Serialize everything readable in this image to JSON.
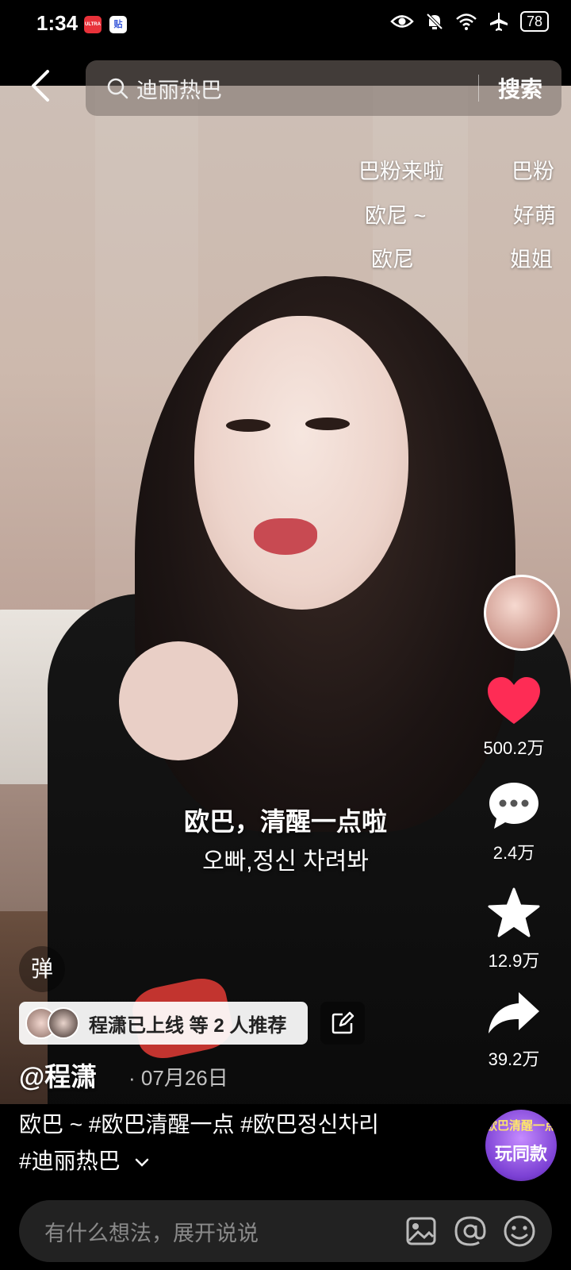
{
  "status_bar": {
    "time": "1:34",
    "app_badge_1": "ULTRA",
    "app_badge_2": "贴",
    "battery": "78"
  },
  "header": {
    "search_query": "迪丽热巴",
    "search_button": "搜索"
  },
  "danmaku": {
    "col1": [
      "巴粉来啦",
      "欧尼 ~",
      "欧尼"
    ],
    "col2": [
      "巴粉",
      "好萌",
      "姐姐"
    ]
  },
  "subtitles": {
    "chinese": "欧巴，清醒一点啦",
    "korean": "오빠,정신 차려봐"
  },
  "actions": {
    "like_count": "500.2万",
    "comment_count": "2.4万",
    "favorite_count": "12.9万",
    "share_count": "39.2万",
    "like_color": "#fe2c55"
  },
  "post": {
    "danmu_toggle": "弹",
    "recommend_text": "程潇已上线 等 2 人推荐",
    "author": "@程潇",
    "date_separator": "·",
    "date": "07月26日",
    "caption_line1": "欧巴 ~ #欧巴清醒一点 #欧巴정신차리",
    "caption_line2": "#迪丽热巴"
  },
  "play_same": {
    "tag": "欧巴清醒一点",
    "label": "玩同款"
  },
  "comment_bar": {
    "placeholder": "有什么想法，展开说说"
  }
}
